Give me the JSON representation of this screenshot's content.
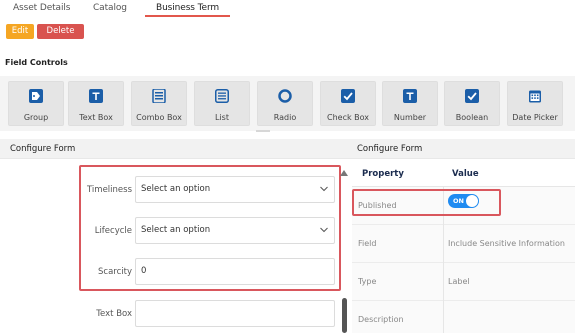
{
  "tabs": [
    {
      "label": "Asset Details"
    },
    {
      "label": "Catalog"
    },
    {
      "label": "Business Term"
    }
  ],
  "actions": {
    "edit_label": "Edit",
    "delete_label": "Delete"
  },
  "field_controls": {
    "title": "Field Controls",
    "items": [
      {
        "label": "Group",
        "icon": "tag-icon"
      },
      {
        "label": "Text Box",
        "icon": "text-box-icon"
      },
      {
        "label": "Combo Box",
        "icon": "combo-box-icon"
      },
      {
        "label": "List",
        "icon": "list-icon"
      },
      {
        "label": "Radio",
        "icon": "radio-icon"
      },
      {
        "label": "Check Box",
        "icon": "checkbox-icon"
      },
      {
        "label": "Number",
        "icon": "number-icon"
      },
      {
        "label": "Boolean",
        "icon": "boolean-icon"
      },
      {
        "label": "Date Picker",
        "icon": "calendar-icon"
      }
    ]
  },
  "configure_form_left": {
    "title": "Configure Form",
    "fields": [
      {
        "label": "Timeliness",
        "value": "Select an option"
      },
      {
        "label": "Lifecycle",
        "value": "Select an option"
      },
      {
        "label": "Scarcity",
        "value": "0"
      },
      {
        "label": "Text Box",
        "value": ""
      }
    ]
  },
  "configure_form_right": {
    "title": "Configure Form",
    "headers": {
      "property": "Property",
      "value": "Value"
    },
    "rows": [
      {
        "property": "Published",
        "value": "ON"
      },
      {
        "property": "Field",
        "value": "Include Sensitive Information"
      },
      {
        "property": "Type",
        "value": "Label"
      },
      {
        "property": "Description",
        "value": ""
      }
    ]
  },
  "colors": {
    "accent_tab": "#e2574c",
    "edit": "#f5a623",
    "delete": "#d9534f",
    "toggle_on": "#1f8bf1",
    "highlight": "#d9575d",
    "icon_blue": "#1b5ea8"
  }
}
